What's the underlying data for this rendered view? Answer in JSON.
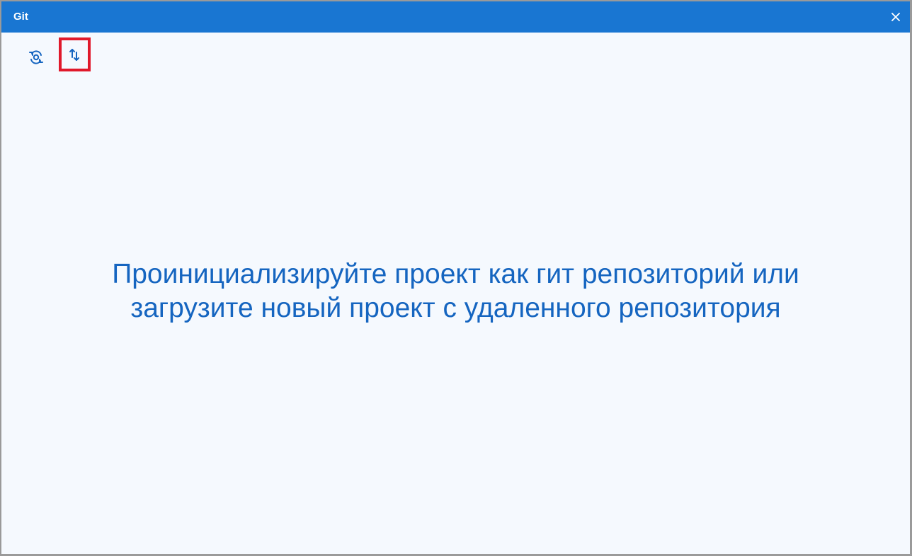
{
  "window": {
    "title": "Git",
    "accent_color": "#1976d2",
    "background_color": "#f5f9fe",
    "text_color": "#1565c0",
    "highlight_color": "#e0192b"
  },
  "toolbar": {
    "buttons": [
      {
        "icon": "git-init-icon",
        "highlighted": false
      },
      {
        "icon": "sync-arrows-icon",
        "highlighted": true
      }
    ]
  },
  "message": {
    "line1": "Проинициализируйте проект как гит репозиторий или",
    "line2": "загрузите новый проект с удаленного репозитория"
  }
}
